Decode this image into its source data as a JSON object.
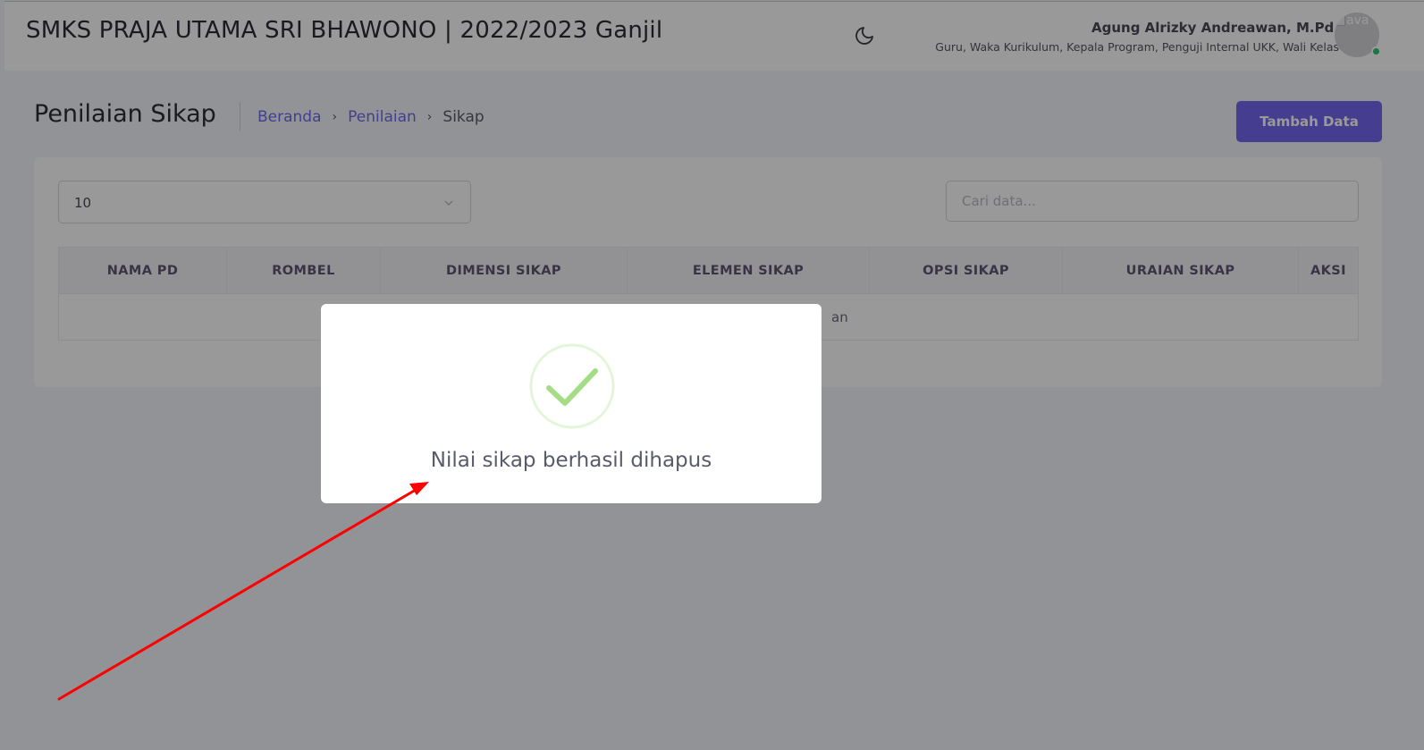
{
  "header": {
    "title": "SMKS PRAJA UTAMA SRI BHAWONO | 2022/2023 Ganjil",
    "theme_icon": "moon-icon",
    "user_name": "Agung Alrizky Andreawan, M.Pd.",
    "user_roles": "Guru, Waka Kurikulum, Kepala Program, Penguji Internal UKK, Wali Kelas",
    "avatar_alt": "ava",
    "status_color": "#28c76f"
  },
  "page": {
    "title": "Penilaian Sikap",
    "breadcrumb": [
      "Beranda",
      "Penilaian",
      "Sikap"
    ],
    "add_button": "Tambah Data",
    "accent_color": "#7367f0"
  },
  "table_controls": {
    "page_size": "10",
    "search_placeholder": "Cari data..."
  },
  "table": {
    "columns": [
      "NAMA PD",
      "ROMBEL",
      "DIMENSI SIKAP",
      "ELEMEN SIKAP",
      "OPSI SIKAP",
      "URAIAN SIKAP",
      "AKSI"
    ],
    "visible_empty_fragment": "an"
  },
  "modal": {
    "icon": "check-circle-icon",
    "message": "Nilai sikap berhasil dihapus",
    "icon_color": "#a5dc86"
  },
  "annotation": {
    "type": "red-arrow",
    "color": "#ff0000"
  }
}
